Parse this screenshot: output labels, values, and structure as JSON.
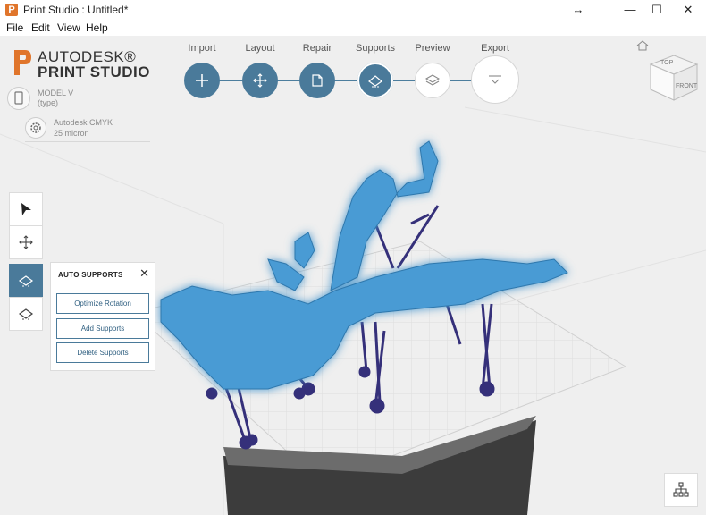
{
  "window": {
    "title": "Print Studio : Untitled*",
    "app_icon_letter": "P",
    "controls": {
      "resize": "↔",
      "minimize": "—",
      "maximize": "☐",
      "close": "✕"
    }
  },
  "menu": {
    "items": [
      "File",
      "Edit",
      "View",
      "Help"
    ]
  },
  "logo": {
    "line1": "AUTODESK®",
    "line2": "PRINT STUDIO"
  },
  "device": {
    "name": "MODEL V",
    "type": "(type)"
  },
  "material": {
    "name": "Autodesk CMYK",
    "resolution": "25 micron"
  },
  "workflow": {
    "steps": [
      {
        "label": "Import",
        "state": "done",
        "icon": "plus-icon"
      },
      {
        "label": "Layout",
        "state": "done",
        "icon": "move-icon"
      },
      {
        "label": "Repair",
        "state": "done",
        "icon": "repair-icon"
      },
      {
        "label": "Supports",
        "state": "active",
        "icon": "supports-icon"
      },
      {
        "label": "Preview",
        "state": "todo",
        "icon": "layers-icon"
      },
      {
        "label": "Export",
        "state": "todo",
        "icon": "export-icon"
      }
    ]
  },
  "tools": [
    "select-arrow-icon",
    "move-icon",
    "auto-supports-icon",
    "manual-supports-icon"
  ],
  "auto_supports_panel": {
    "title": "AUTO SUPPORTS",
    "close": "✕",
    "buttons": [
      "Optimize Rotation",
      "Add Supports",
      "Delete Supports"
    ]
  },
  "viewcube": {
    "top": "TOP",
    "front": "FRONT"
  },
  "colors": {
    "accent": "#4a7a9a",
    "model": "#4a9bd4",
    "supports": "#35307a",
    "logo_orange": "#e0752b"
  }
}
